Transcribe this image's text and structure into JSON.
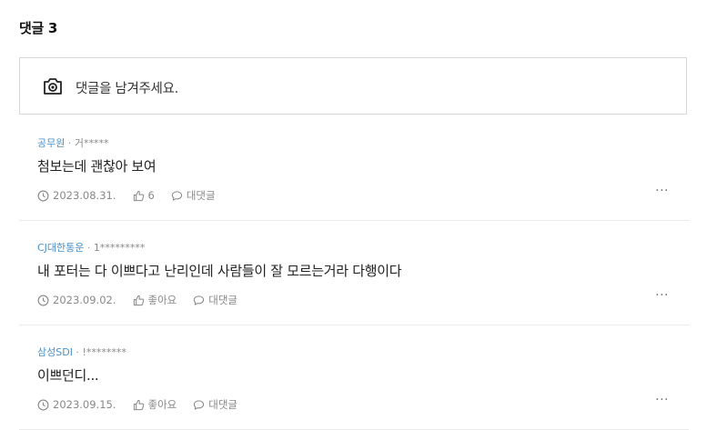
{
  "header": {
    "title": "댓글 3"
  },
  "composer": {
    "placeholder": "댓글을 남겨주세요."
  },
  "comments": [
    {
      "author": "공무원",
      "separator": " · ",
      "masked_id": "거*****",
      "text": "첨보는데 괜찮아 보여",
      "date": "2023.08.31.",
      "like_label": "6",
      "reply_label": "대댓글",
      "more": "···"
    },
    {
      "author": "CJ대한통운",
      "separator": " · ",
      "masked_id": "1*********",
      "text": "내 포터는 다 이쁘다고 난리인데 사람들이 잘 모르는거라 다행이다",
      "date": "2023.09.02.",
      "like_label": "좋아요",
      "reply_label": "대댓글",
      "more": "···"
    },
    {
      "author": "삼성SDI",
      "separator": " · ",
      "masked_id": "!********",
      "text": "이쁘던디...",
      "date": "2023.09.15.",
      "like_label": "좋아요",
      "reply_label": "대댓글",
      "more": "···"
    }
  ],
  "icons": {
    "composer": "camera-icon",
    "date": "clock-icon",
    "like": "thumbs-up-icon",
    "reply": "speech-bubble-icon",
    "more": "more-icon"
  },
  "colors": {
    "author": "#4a90c8",
    "border": "#d6d6d6",
    "muted": "#888888"
  }
}
